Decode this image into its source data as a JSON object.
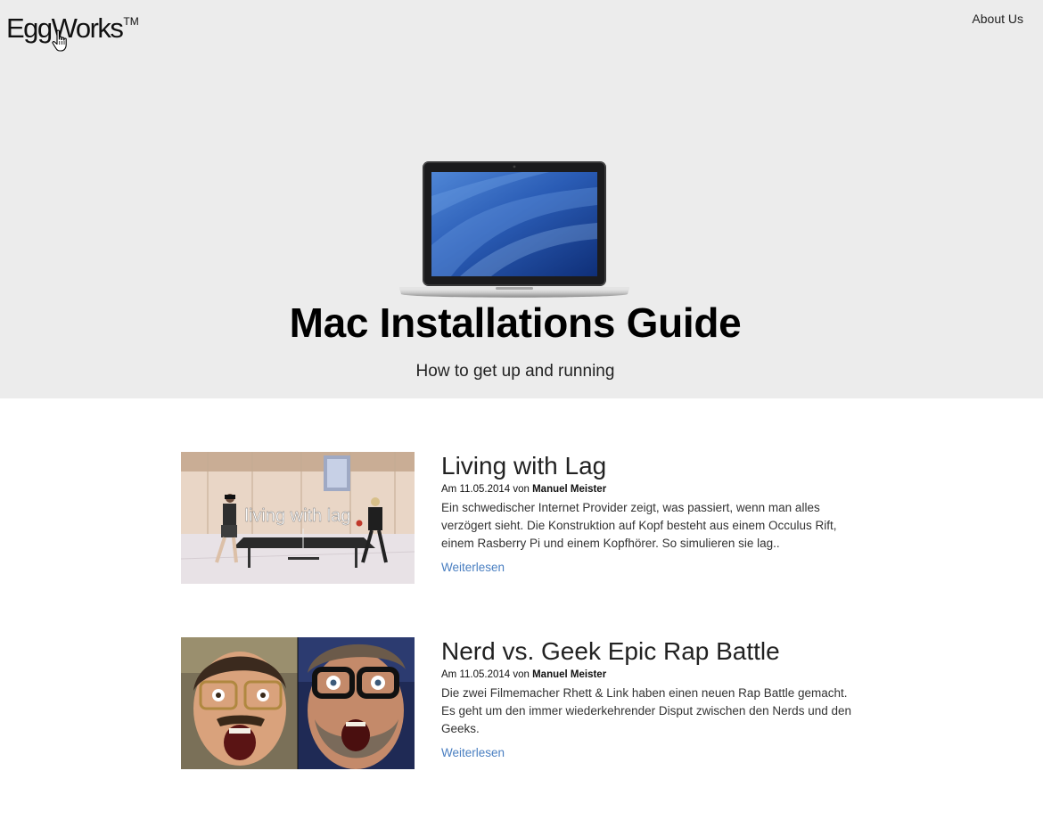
{
  "header": {
    "logo_text": "EggWorks",
    "logo_tm": "TM",
    "nav": {
      "about_label": "About Us"
    }
  },
  "hero": {
    "title": "Mac Installations Guide",
    "subtitle": "How to get up and running",
    "image_icon": "laptop-icon"
  },
  "posts": [
    {
      "title": "Living with Lag",
      "meta_prefix": "Am 11.05.2014 von",
      "author": "Manuel Meister",
      "excerpt": "Ein schwedischer Internet Provider zeigt, was passiert, wenn man alles verzögert sieht. Die Konstruktion auf Kopf besteht aus einem Occulus Rift, einem Rasberry Pi und einem Kopfhörer. So simulieren sie lag..",
      "read_more": "Weiterlesen",
      "image_caption": "living with lag"
    },
    {
      "title": "Nerd vs. Geek Epic Rap Battle",
      "meta_prefix": "Am 11.05.2014 von",
      "author": "Manuel Meister",
      "excerpt": "Die zwei Filmemacher Rhett & Link haben einen neuen Rap Battle gemacht. Es geht um den immer wiederkehrender Disput zwischen den Nerds und den Geeks.",
      "read_more": "Weiterlesen"
    }
  ],
  "colors": {
    "hero_background": "#ececec",
    "link": "#4a7fc1",
    "text": "#222222"
  }
}
